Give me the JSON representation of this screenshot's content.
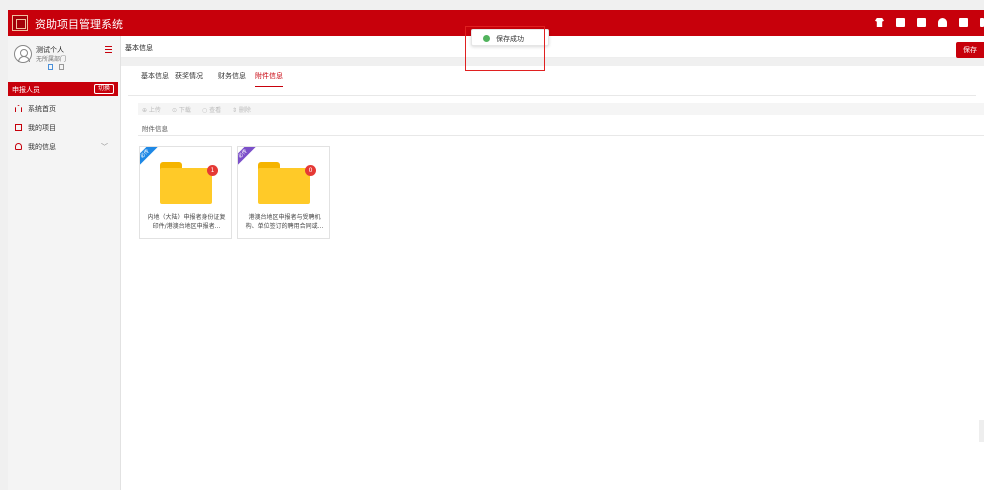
{
  "app": {
    "title": "资助项目管理系统",
    "logo_icon": "seal-logo-icon"
  },
  "topbar": {
    "background": "#c7000b",
    "icons": [
      "tshirt-icon",
      "plus-square-icon",
      "chat-icon",
      "bell-icon",
      "help-icon",
      "exit-icon"
    ]
  },
  "user": {
    "name": "测试个人",
    "department": "无所属部门"
  },
  "sidebar": {
    "role_label": "申报人员",
    "switch_label": "切换",
    "items": [
      {
        "label": "系统首页",
        "icon": "home-icon"
      },
      {
        "label": "我的项目",
        "icon": "folder-icon"
      },
      {
        "label": "我的信息",
        "icon": "user-icon",
        "chevron": "﹀"
      }
    ]
  },
  "breadcrumb": {
    "title": "基本信息",
    "save_label": "保存"
  },
  "toast": {
    "text": "保存成功",
    "status": "success"
  },
  "tabs": [
    {
      "label": "基本信息",
      "active": false
    },
    {
      "label": "获奖情况",
      "active": false
    },
    {
      "label": "财务信息",
      "active": false
    },
    {
      "label": "附件信息",
      "active": true
    }
  ],
  "toolbar": [
    {
      "label": "⊕ 上传"
    },
    {
      "label": "⊙ 下载"
    },
    {
      "label": "○ 查看"
    },
    {
      "label": "⇕ 删除"
    }
  ],
  "section_label": "附件信息",
  "attachments": [
    {
      "ribbon": "必传",
      "ribbon_color": "#1e88e5",
      "count": "1",
      "title": "内地（大陆）申报者身份证复印件/港澳台地区申报者..."
    },
    {
      "ribbon": "必传",
      "ribbon_color": "#7b4fc9",
      "count": "0",
      "title": "港澳台地区申报者与受聘机构、单位签订的聘用合同或..."
    }
  ]
}
